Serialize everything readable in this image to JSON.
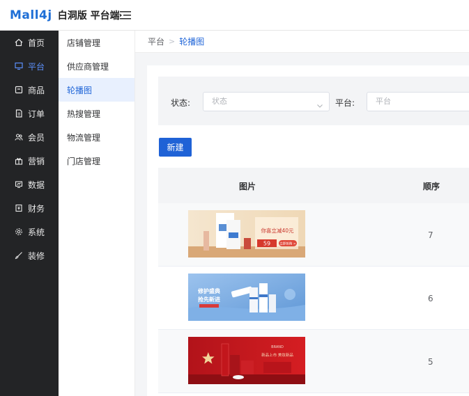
{
  "header": {
    "logo_brand": "Mall4j",
    "logo_sub": "白洞版 平台端"
  },
  "sidebar": {
    "items": [
      {
        "label": "首页",
        "icon": "home-icon"
      },
      {
        "label": "平台",
        "icon": "monitor-icon",
        "active": true
      },
      {
        "label": "商品",
        "icon": "box-icon"
      },
      {
        "label": "订单",
        "icon": "document-icon"
      },
      {
        "label": "会员",
        "icon": "users-icon"
      },
      {
        "label": "营销",
        "icon": "gift-icon"
      },
      {
        "label": "数据",
        "icon": "chart-icon"
      },
      {
        "label": "财务",
        "icon": "wallet-icon"
      },
      {
        "label": "系统",
        "icon": "gear-icon"
      },
      {
        "label": "装修",
        "icon": "brush-icon"
      }
    ]
  },
  "subnav": {
    "items": [
      {
        "label": "店铺管理"
      },
      {
        "label": "供应商管理"
      },
      {
        "label": "轮播图",
        "active": true
      },
      {
        "label": "热搜管理"
      },
      {
        "label": "物流管理"
      },
      {
        "label": "门店管理"
      }
    ]
  },
  "breadcrumb": {
    "root": "平台",
    "separator": ">",
    "current": "轮播图"
  },
  "filter": {
    "status_label": "状态:",
    "status_placeholder": "状态",
    "platform_label": "平台:",
    "platform_placeholder": "平台"
  },
  "actions": {
    "new_label": "新建"
  },
  "table": {
    "columns": [
      "图片",
      "顺序"
    ],
    "rows": [
      {
        "order": "7",
        "banner_text": "你喜立减40元",
        "banner_price": "59",
        "banner_cta": "立即抢购 >"
      },
      {
        "order": "6",
        "banner_text": "修护盛典",
        "banner_text2": "抢先新进"
      },
      {
        "order": "5",
        "banner_text": "BRAND",
        "banner_text2": "新品上市 美妆新品"
      }
    ]
  },
  "colors": {
    "accent": "#1f62d6",
    "sidebar_bg": "#232426",
    "active_sub_bg": "#e8f0fe"
  }
}
